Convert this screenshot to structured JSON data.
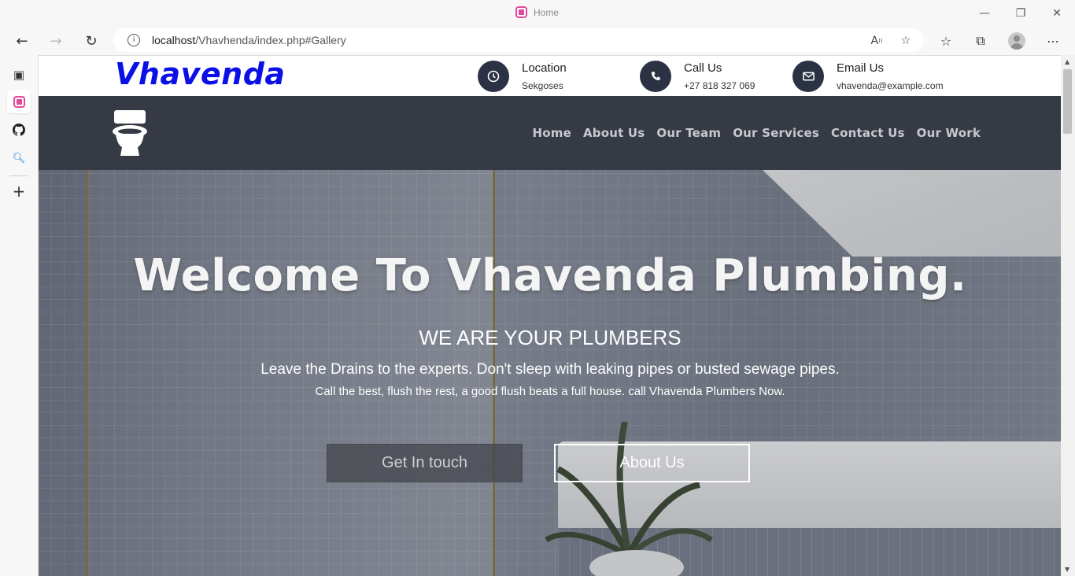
{
  "browser": {
    "tab_title": "Home",
    "url_host": "localhost",
    "url_path": "/Vhavhenda/index.php#Gallery"
  },
  "site": {
    "brand": "Vhavenda",
    "contacts": [
      {
        "label": "Location",
        "value": "Sekgoses",
        "icon": "clock-icon"
      },
      {
        "label": "Call Us",
        "value": "+27 818 327 069",
        "icon": "phone-icon"
      },
      {
        "label": "Email Us",
        "value": "vhavenda@example.com",
        "icon": "envelope-icon"
      }
    ],
    "nav": [
      "Home",
      "About Us",
      "Our Team",
      "Our Services",
      "Contact Us",
      "Our Work"
    ],
    "colors": {
      "brand": "#0a10e6",
      "navbar": "#353a45",
      "icon_circle": "#2b3243"
    }
  },
  "hero": {
    "title": "Welcome To Vhavenda Plumbing.",
    "subtitle": "WE ARE YOUR PLUMBERS",
    "line1": "Leave the Drains to the experts. Don't sleep with leaking pipes or busted sewage pipes.",
    "line2": "Call the best, flush the rest, a good flush beats a full house. call Vhavenda Plumbers Now.",
    "btn_primary": "Get In touch",
    "btn_secondary": "About Us"
  }
}
